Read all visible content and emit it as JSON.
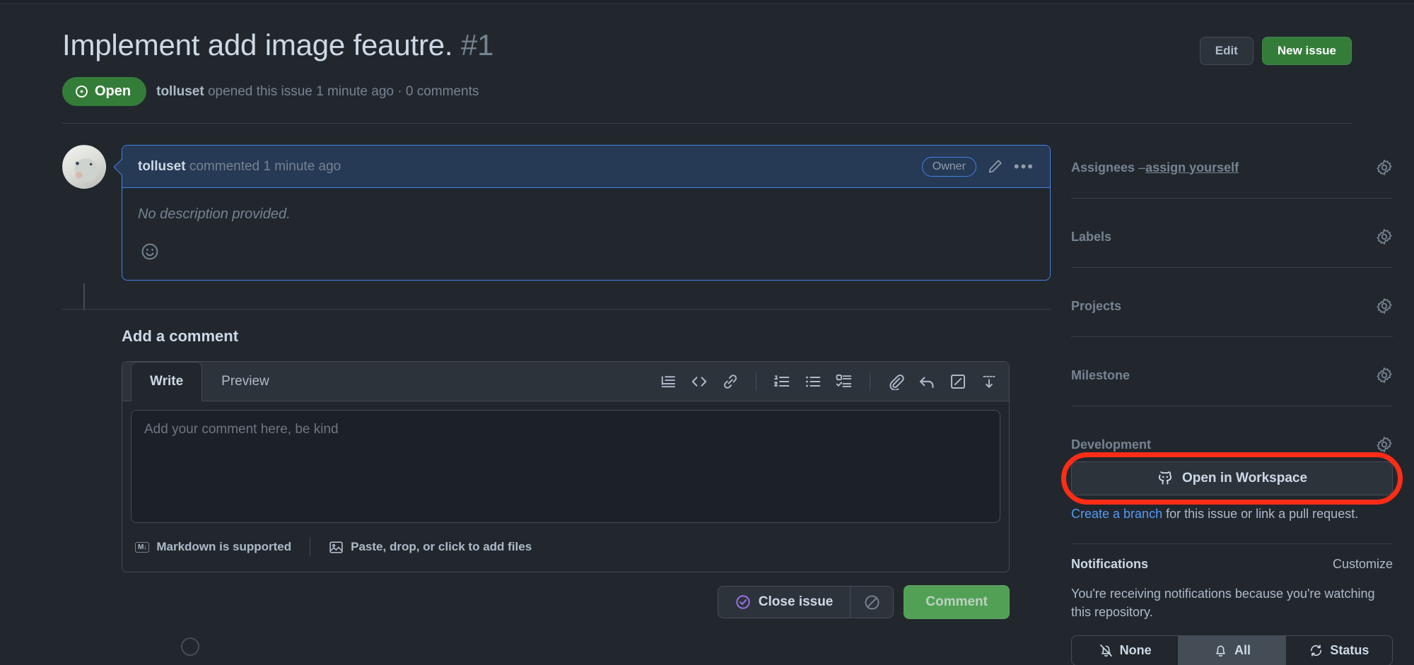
{
  "header": {
    "title": "Implement add image feautre.",
    "number": "#1",
    "edit_label": "Edit",
    "new_issue_label": "New issue",
    "state": "Open",
    "meta_author": "tolluset",
    "meta_rest": " opened this issue 1 minute ago · 0 comments"
  },
  "comment": {
    "author": "tolluset",
    "meta": " commented 1 minute ago",
    "owner_badge": "Owner",
    "body": "No description provided."
  },
  "composer": {
    "heading": "Add a comment",
    "tab_write": "Write",
    "tab_preview": "Preview",
    "placeholder": "Add your comment here, be kind",
    "markdown_chip": "M↓",
    "markdown_label": "Markdown is supported",
    "files_label": "Paste, drop, or click to add files",
    "close_issue_label": "Close issue",
    "comment_label": "Comment",
    "toolbar_icons": [
      "blockquote-icon",
      "code-icon",
      "link-icon",
      "ordered-list-icon",
      "unordered-list-icon",
      "task-list-icon",
      "attachment-icon",
      "reply-icon",
      "saved-reply-icon",
      "hide-toolbar-icon"
    ]
  },
  "sidebar": {
    "assignees_label": "Assignees",
    "assignees_sep": " – ",
    "assign_yourself": "assign yourself",
    "labels_label": "Labels",
    "projects_label": "Projects",
    "milestone_label": "Milestone",
    "development_label": "Development",
    "workspace_button": "Open in Workspace",
    "create_branch": "Create a branch",
    "dev_note_rest": " for this issue or link a pull request.",
    "notifications_label": "Notifications",
    "customize_label": "Customize",
    "notifications_text": "You're receiving notifications because you're watching this repository.",
    "seg_none": "None",
    "seg_all": "All",
    "seg_status": "Status"
  },
  "colors": {
    "page_bg": "#22272e",
    "accent_green": "#347d39",
    "comment_border": "#4184e4",
    "comment_head_bg": "#263955",
    "highlight_red": "#ff2d16",
    "link_blue": "#539bf5",
    "close_purple": "#986ee2",
    "comment_btn_green": "#57ab5a"
  }
}
